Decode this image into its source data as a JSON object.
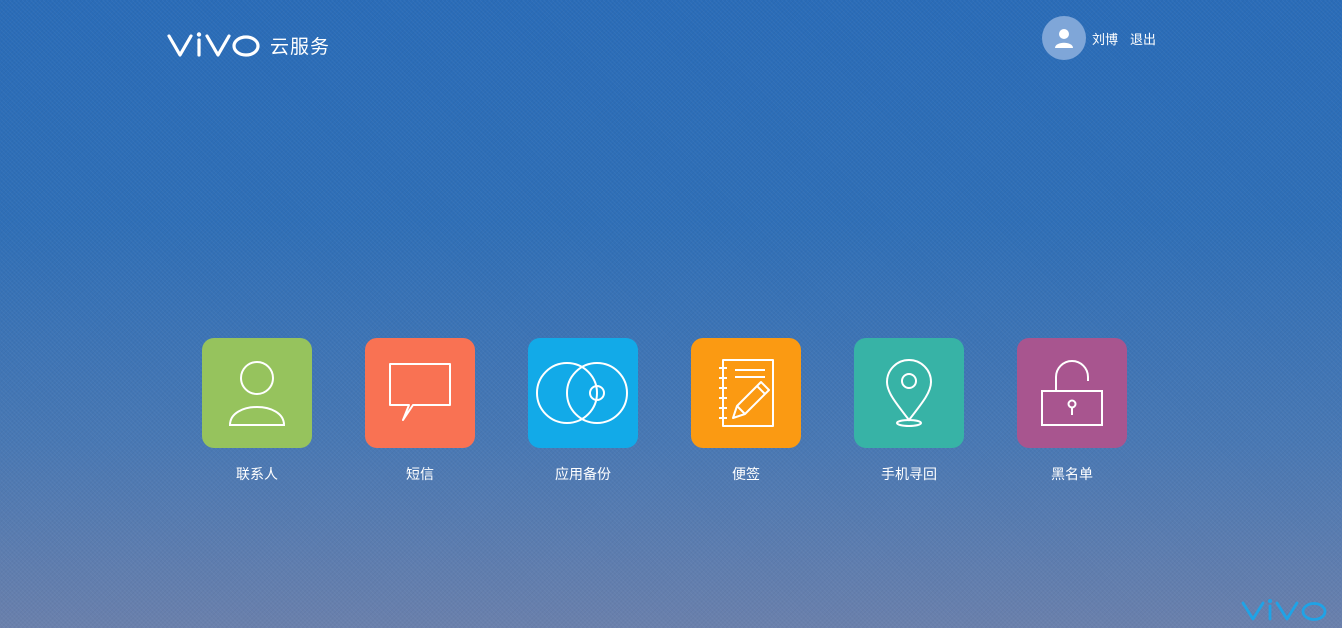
{
  "header": {
    "brand": "vivo",
    "brand_sub": "云服务"
  },
  "user": {
    "name": "刘博",
    "logout_label": "退出"
  },
  "tiles": [
    {
      "label": "联系人",
      "color": "#96c35d",
      "icon": "contact-icon"
    },
    {
      "label": "短信",
      "color": "#f97253",
      "icon": "message-icon"
    },
    {
      "label": "应用备份",
      "color": "#12aae8",
      "icon": "disc-icon"
    },
    {
      "label": "便签",
      "color": "#fb9a12",
      "icon": "notepad-icon"
    },
    {
      "label": "手机寻回",
      "color": "#37b3a6",
      "icon": "location-pin-icon"
    },
    {
      "label": "黑名单",
      "color": "#a8558f",
      "icon": "unlock-icon"
    }
  ],
  "footer": {
    "brand": "vivo",
    "brand_color": "#1fa3e6"
  }
}
